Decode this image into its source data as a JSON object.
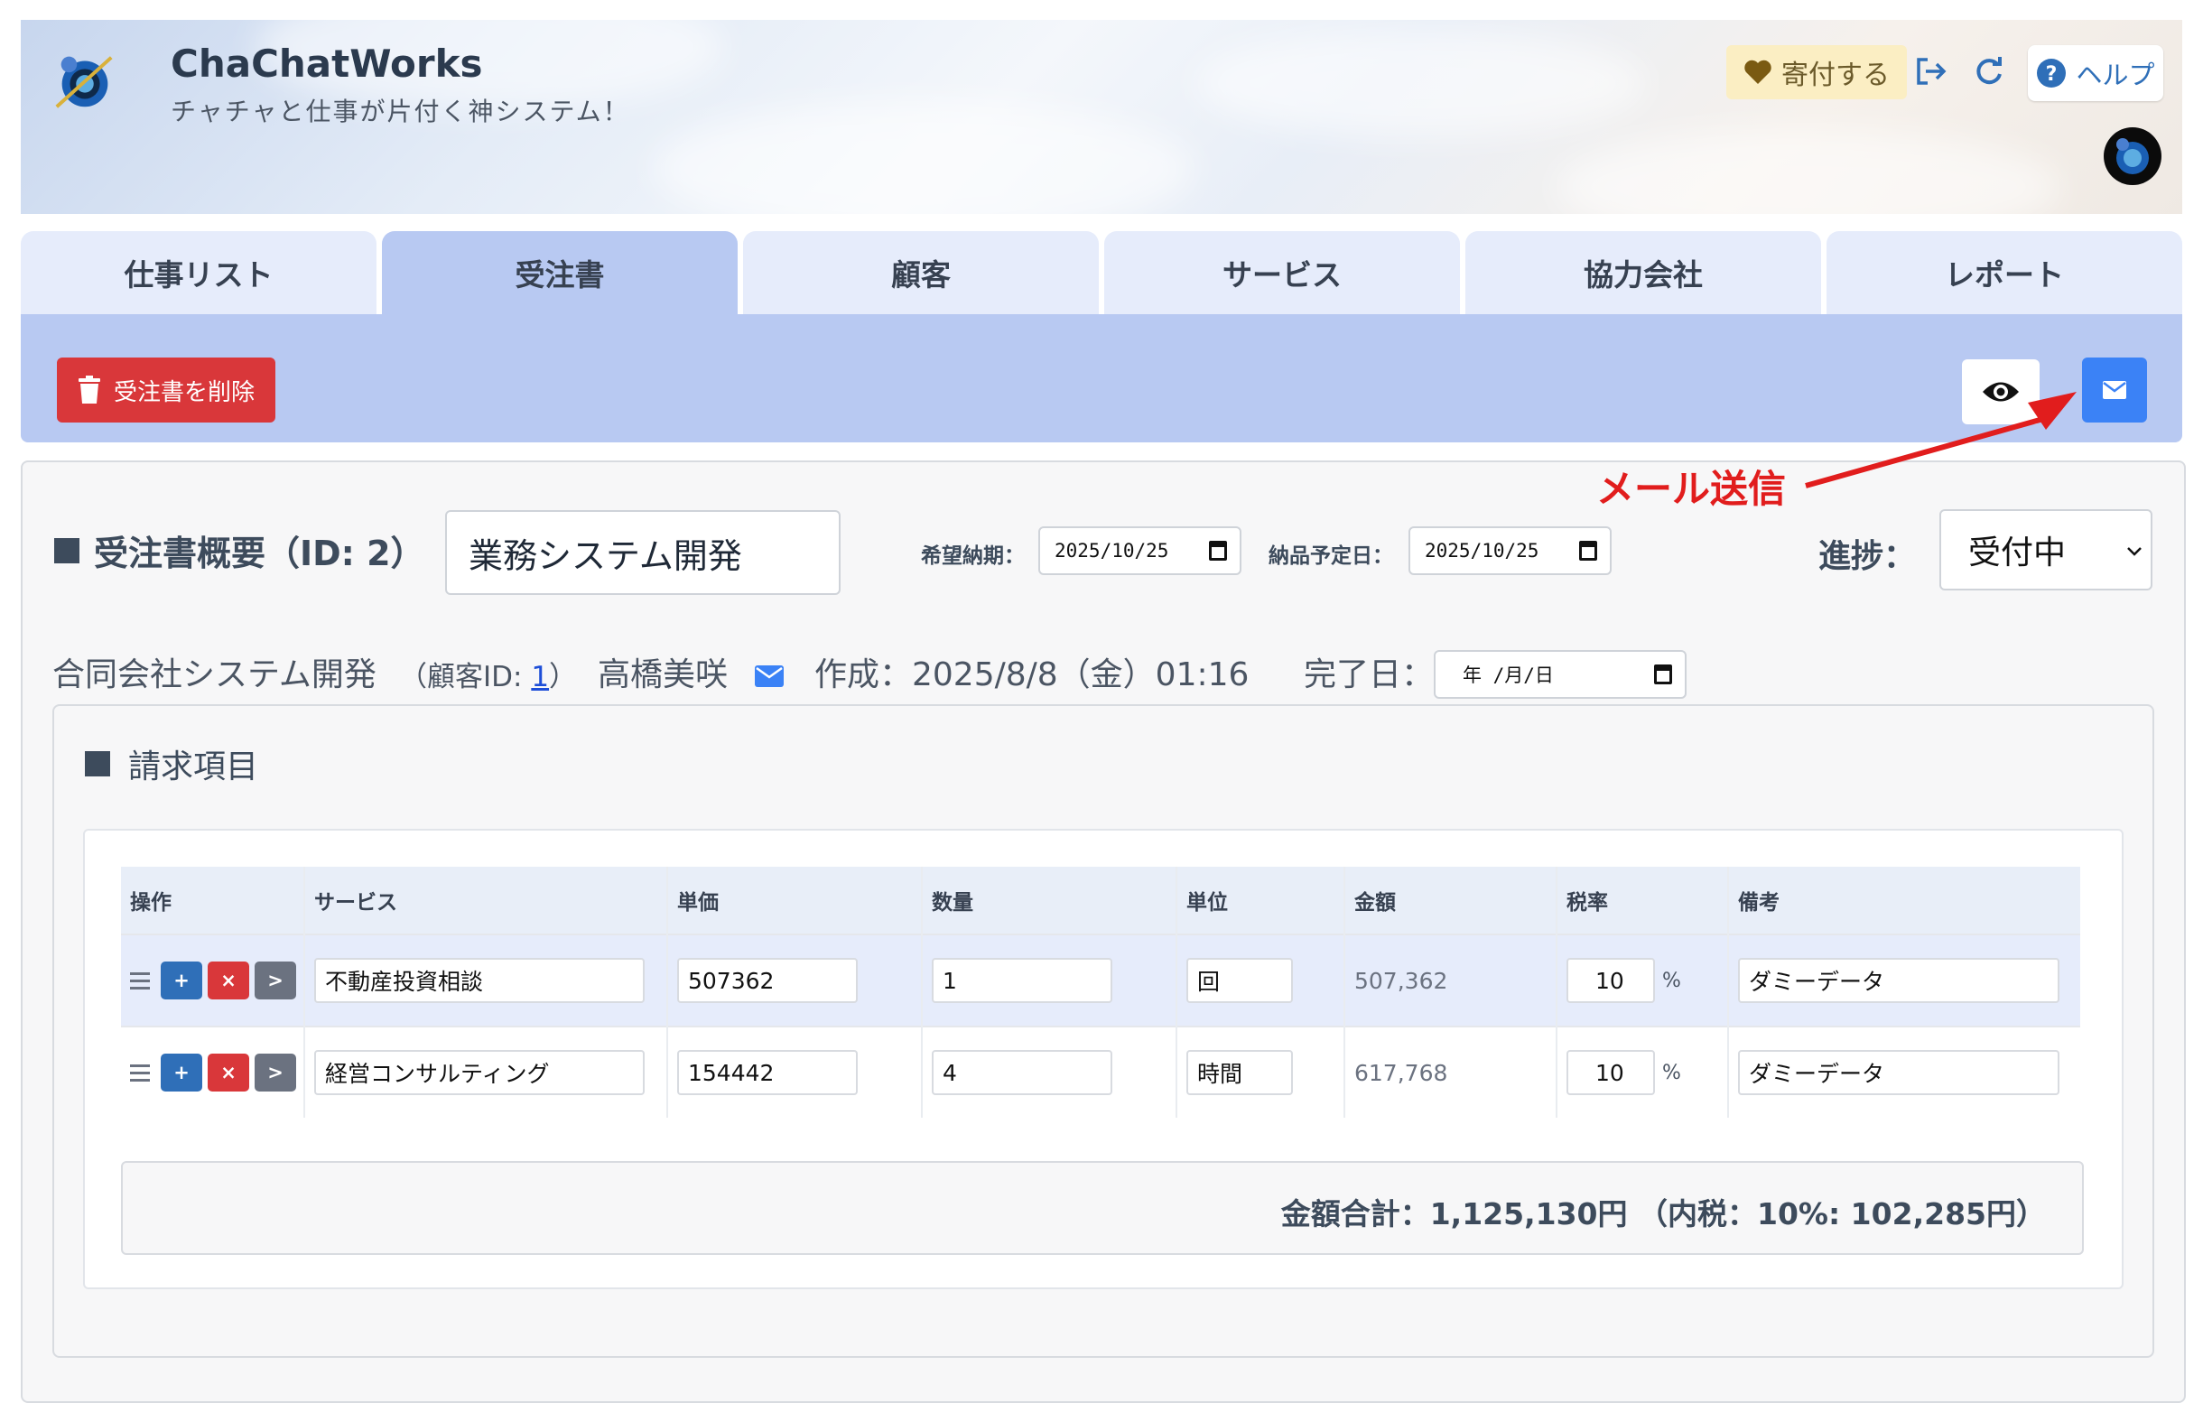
{
  "app": {
    "name": "ChaChatWorks",
    "tagline": "チャチャと仕事が片付く神システム！",
    "donate_label": "寄付する",
    "help_label": "ヘルプ"
  },
  "tabs": [
    {
      "label": "仕事リスト",
      "active": false
    },
    {
      "label": "受注書",
      "active": true
    },
    {
      "label": "顧客",
      "active": false
    },
    {
      "label": "サービス",
      "active": false
    },
    {
      "label": "協力会社",
      "active": false
    },
    {
      "label": "レポート",
      "active": false
    }
  ],
  "toolbar": {
    "delete_label": "受注書を削除",
    "annotation": "メール送信",
    "annotation_color": "#e11d1d"
  },
  "order": {
    "section_title": "受注書概要（ID: 2）",
    "title_value": "業務システム開発",
    "desired_date_label": "希望納期：",
    "desired_date_value": "2025/10/25",
    "delivery_date_label": "納品予定日：",
    "delivery_date_value": "2025/10/25",
    "progress_label": "進捗：",
    "progress_value": "受付中",
    "customer_name": "合同会社システム開発",
    "customer_id_prefix": "（顧客ID: ",
    "customer_id": "1",
    "customer_id_suffix": "）",
    "contact_name": "高橋美咲",
    "created": "作成：2025/8/8（金）01:16",
    "completed_label": "完了日：",
    "completed_placeholder": "年 /月/日"
  },
  "items": {
    "section_title": "請求項目",
    "headers": [
      "操作",
      "サービス",
      "単価",
      "数量",
      "単位",
      "金額",
      "税率",
      "備考"
    ],
    "op_labels": {
      "add": "+",
      "remove": "×",
      "go": ">"
    },
    "rows": [
      {
        "service": "不動産投資相談",
        "unit_price": "507362",
        "qty": "1",
        "unit": "回",
        "amount": "507,362",
        "tax": "10",
        "pct": "%",
        "note": "ダミーデータ"
      },
      {
        "service": "経営コンサルティング",
        "unit_price": "154442",
        "qty": "4",
        "unit": "時間",
        "amount": "617,768",
        "tax": "10",
        "pct": "%",
        "note": "ダミーデータ"
      }
    ],
    "total": "金額合計：1,125,130円 （内税：10%: 102,285円）"
  },
  "colors": {
    "tab_active": "#b8c9f2",
    "tab_inactive": "#e6ecfb",
    "danger": "#d9373a",
    "primary": "#3b82f6"
  }
}
